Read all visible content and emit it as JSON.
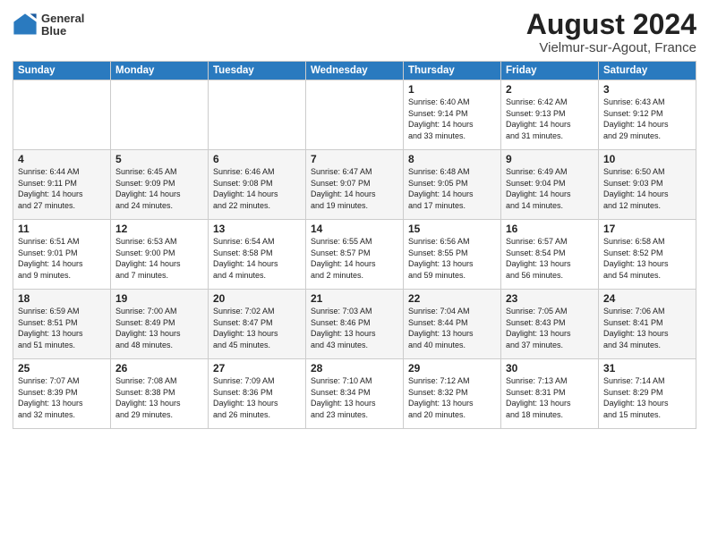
{
  "logo": {
    "text_line1": "General",
    "text_line2": "Blue"
  },
  "title": "August 2024",
  "subtitle": "Vielmur-sur-Agout, France",
  "days_of_week": [
    "Sunday",
    "Monday",
    "Tuesday",
    "Wednesday",
    "Thursday",
    "Friday",
    "Saturday"
  ],
  "weeks": [
    [
      {
        "num": "",
        "info": ""
      },
      {
        "num": "",
        "info": ""
      },
      {
        "num": "",
        "info": ""
      },
      {
        "num": "",
        "info": ""
      },
      {
        "num": "1",
        "info": "Sunrise: 6:40 AM\nSunset: 9:14 PM\nDaylight: 14 hours\nand 33 minutes."
      },
      {
        "num": "2",
        "info": "Sunrise: 6:42 AM\nSunset: 9:13 PM\nDaylight: 14 hours\nand 31 minutes."
      },
      {
        "num": "3",
        "info": "Sunrise: 6:43 AM\nSunset: 9:12 PM\nDaylight: 14 hours\nand 29 minutes."
      }
    ],
    [
      {
        "num": "4",
        "info": "Sunrise: 6:44 AM\nSunset: 9:11 PM\nDaylight: 14 hours\nand 27 minutes."
      },
      {
        "num": "5",
        "info": "Sunrise: 6:45 AM\nSunset: 9:09 PM\nDaylight: 14 hours\nand 24 minutes."
      },
      {
        "num": "6",
        "info": "Sunrise: 6:46 AM\nSunset: 9:08 PM\nDaylight: 14 hours\nand 22 minutes."
      },
      {
        "num": "7",
        "info": "Sunrise: 6:47 AM\nSunset: 9:07 PM\nDaylight: 14 hours\nand 19 minutes."
      },
      {
        "num": "8",
        "info": "Sunrise: 6:48 AM\nSunset: 9:05 PM\nDaylight: 14 hours\nand 17 minutes."
      },
      {
        "num": "9",
        "info": "Sunrise: 6:49 AM\nSunset: 9:04 PM\nDaylight: 14 hours\nand 14 minutes."
      },
      {
        "num": "10",
        "info": "Sunrise: 6:50 AM\nSunset: 9:03 PM\nDaylight: 14 hours\nand 12 minutes."
      }
    ],
    [
      {
        "num": "11",
        "info": "Sunrise: 6:51 AM\nSunset: 9:01 PM\nDaylight: 14 hours\nand 9 minutes."
      },
      {
        "num": "12",
        "info": "Sunrise: 6:53 AM\nSunset: 9:00 PM\nDaylight: 14 hours\nand 7 minutes."
      },
      {
        "num": "13",
        "info": "Sunrise: 6:54 AM\nSunset: 8:58 PM\nDaylight: 14 hours\nand 4 minutes."
      },
      {
        "num": "14",
        "info": "Sunrise: 6:55 AM\nSunset: 8:57 PM\nDaylight: 14 hours\nand 2 minutes."
      },
      {
        "num": "15",
        "info": "Sunrise: 6:56 AM\nSunset: 8:55 PM\nDaylight: 13 hours\nand 59 minutes."
      },
      {
        "num": "16",
        "info": "Sunrise: 6:57 AM\nSunset: 8:54 PM\nDaylight: 13 hours\nand 56 minutes."
      },
      {
        "num": "17",
        "info": "Sunrise: 6:58 AM\nSunset: 8:52 PM\nDaylight: 13 hours\nand 54 minutes."
      }
    ],
    [
      {
        "num": "18",
        "info": "Sunrise: 6:59 AM\nSunset: 8:51 PM\nDaylight: 13 hours\nand 51 minutes."
      },
      {
        "num": "19",
        "info": "Sunrise: 7:00 AM\nSunset: 8:49 PM\nDaylight: 13 hours\nand 48 minutes."
      },
      {
        "num": "20",
        "info": "Sunrise: 7:02 AM\nSunset: 8:47 PM\nDaylight: 13 hours\nand 45 minutes."
      },
      {
        "num": "21",
        "info": "Sunrise: 7:03 AM\nSunset: 8:46 PM\nDaylight: 13 hours\nand 43 minutes."
      },
      {
        "num": "22",
        "info": "Sunrise: 7:04 AM\nSunset: 8:44 PM\nDaylight: 13 hours\nand 40 minutes."
      },
      {
        "num": "23",
        "info": "Sunrise: 7:05 AM\nSunset: 8:43 PM\nDaylight: 13 hours\nand 37 minutes."
      },
      {
        "num": "24",
        "info": "Sunrise: 7:06 AM\nSunset: 8:41 PM\nDaylight: 13 hours\nand 34 minutes."
      }
    ],
    [
      {
        "num": "25",
        "info": "Sunrise: 7:07 AM\nSunset: 8:39 PM\nDaylight: 13 hours\nand 32 minutes."
      },
      {
        "num": "26",
        "info": "Sunrise: 7:08 AM\nSunset: 8:38 PM\nDaylight: 13 hours\nand 29 minutes."
      },
      {
        "num": "27",
        "info": "Sunrise: 7:09 AM\nSunset: 8:36 PM\nDaylight: 13 hours\nand 26 minutes."
      },
      {
        "num": "28",
        "info": "Sunrise: 7:10 AM\nSunset: 8:34 PM\nDaylight: 13 hours\nand 23 minutes."
      },
      {
        "num": "29",
        "info": "Sunrise: 7:12 AM\nSunset: 8:32 PM\nDaylight: 13 hours\nand 20 minutes."
      },
      {
        "num": "30",
        "info": "Sunrise: 7:13 AM\nSunset: 8:31 PM\nDaylight: 13 hours\nand 18 minutes."
      },
      {
        "num": "31",
        "info": "Sunrise: 7:14 AM\nSunset: 8:29 PM\nDaylight: 13 hours\nand 15 minutes."
      }
    ]
  ]
}
